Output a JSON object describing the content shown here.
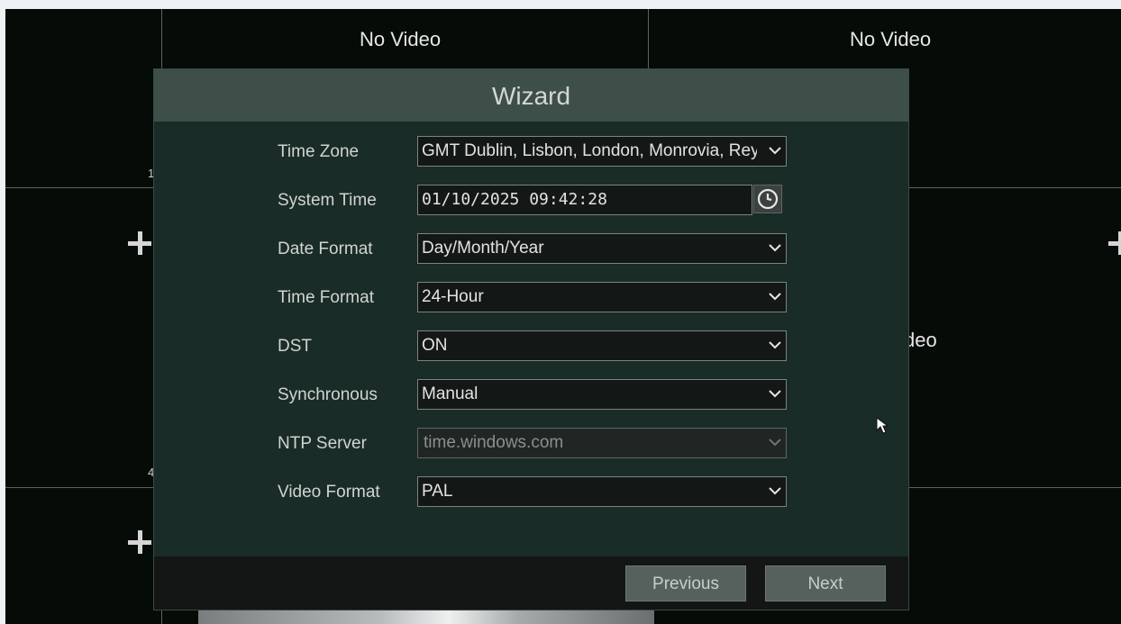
{
  "background": {
    "no_video_label": "No Video",
    "channel_numbers": [
      "1",
      "4"
    ],
    "partial_text": "deo"
  },
  "wizard": {
    "title": "Wizard",
    "fields": {
      "time_zone": {
        "label": "Time Zone",
        "value": "GMT Dublin, Lisbon, London, Monrovia, Reykjavik"
      },
      "system_time": {
        "label": "System Time",
        "value": "01/10/2025 09:42:28"
      },
      "date_format": {
        "label": "Date Format",
        "value": "Day/Month/Year"
      },
      "time_format": {
        "label": "Time Format",
        "value": "24-Hour"
      },
      "dst": {
        "label": "DST",
        "value": "ON"
      },
      "synchronous": {
        "label": "Synchronous",
        "value": "Manual"
      },
      "ntp_server": {
        "label": "NTP Server",
        "value": "time.windows.com"
      },
      "video_format": {
        "label": "Video Format",
        "value": "PAL"
      }
    },
    "buttons": {
      "previous": "Previous",
      "next": "Next"
    }
  },
  "icons": [
    "plus-icon",
    "clock-icon",
    "chevron-down-icon",
    "mouse-cursor-icon"
  ],
  "colors": {
    "dialog_bg": "#1a2c27",
    "title_bar": "#3e4f49",
    "button": "#56615d",
    "video_bg": "#050b07"
  }
}
